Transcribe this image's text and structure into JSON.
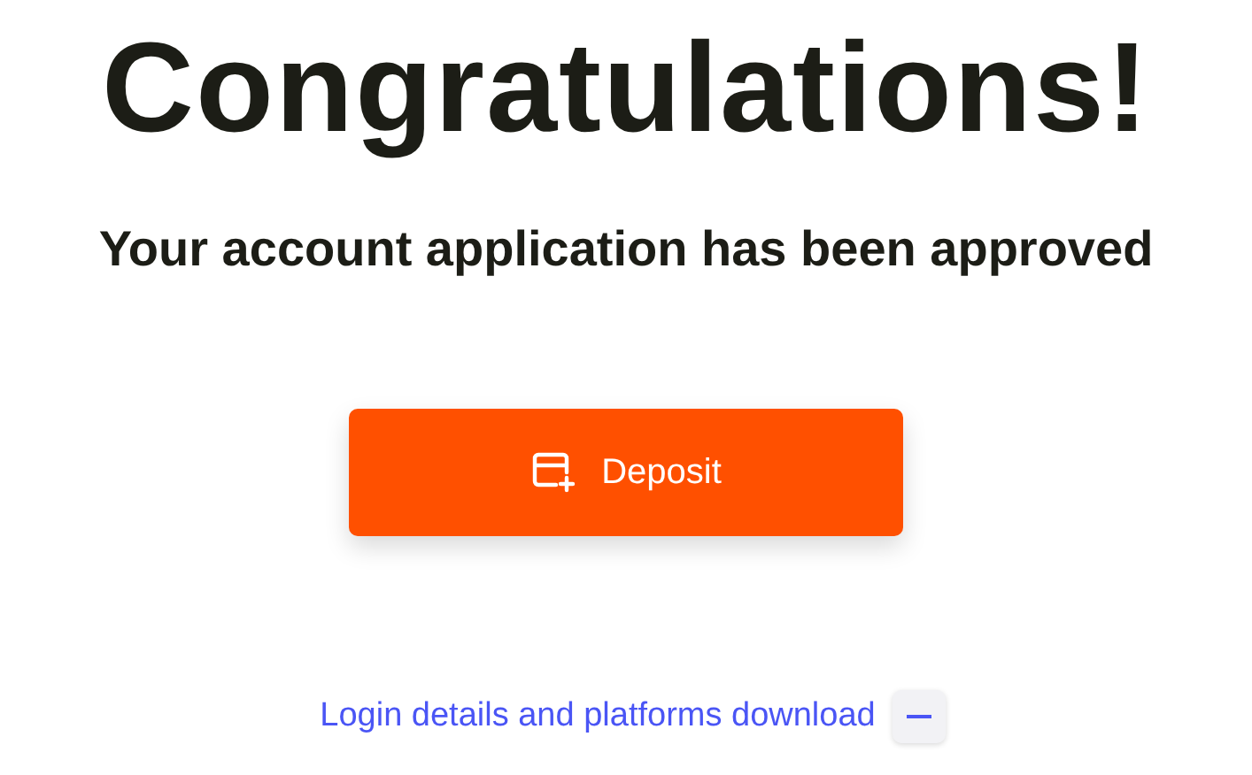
{
  "heading": "Congratulations!",
  "subheading": "Your account application has been approved",
  "deposit_button": {
    "label": "Deposit"
  },
  "details_toggle": {
    "label": "Login details and platforms download",
    "expanded": true
  }
}
